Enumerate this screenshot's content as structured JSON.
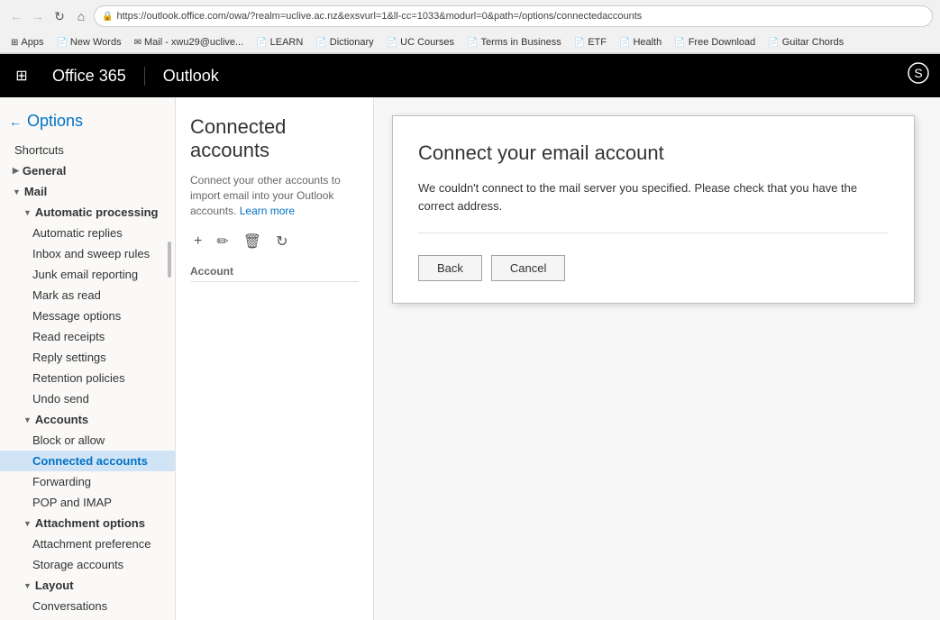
{
  "browser": {
    "nav_back_disabled": true,
    "nav_forward_disabled": true,
    "nav_refresh": "↻",
    "nav_home": "⌂",
    "address": "https://outlook.office.com/owa/?realm=uclive.ac.nz&exsvurl=1&ll-cc=1033&modurl=0&path=/options/connectedaccounts",
    "lock_icon": "🔒",
    "bookmarks": [
      {
        "label": "Apps",
        "icon": "⊞"
      },
      {
        "label": "New Words",
        "icon": "📄"
      },
      {
        "label": "Mail - xwu29@uclive...",
        "icon": "✉"
      },
      {
        "label": "LEARN",
        "icon": "📄"
      },
      {
        "label": "Dictionary",
        "icon": "📄"
      },
      {
        "label": "UC Courses",
        "icon": "📄"
      },
      {
        "label": "Terms in Business",
        "icon": "📄"
      },
      {
        "label": "ETF",
        "icon": "📄"
      },
      {
        "label": "Health",
        "icon": "📄"
      },
      {
        "label": "Free Download",
        "icon": "📄"
      },
      {
        "label": "Guitar Chords",
        "icon": "📄"
      }
    ]
  },
  "appbar": {
    "grid_icon": "⊞",
    "product": "Office 365",
    "app": "Outlook",
    "skype_icon": "S"
  },
  "sidebar": {
    "back_icon": "←",
    "title": "Options",
    "shortcuts": "Shortcuts",
    "general": "General",
    "mail": "Mail",
    "automatic_processing": "Automatic processing",
    "automatic_replies": "Automatic replies",
    "inbox_sweep": "Inbox and sweep rules",
    "junk_email": "Junk email reporting",
    "mark_as_read": "Mark as read",
    "message_options": "Message options",
    "read_receipts": "Read receipts",
    "reply_settings": "Reply settings",
    "retention_policies": "Retention policies",
    "undo_send": "Undo send",
    "accounts": "Accounts",
    "block_or_allow": "Block or allow",
    "connected_accounts": "Connected accounts",
    "forwarding": "Forwarding",
    "pop_imap": "POP and IMAP",
    "attachment_options": "Attachment options",
    "attachment_preference": "Attachment preference",
    "storage_accounts": "Storage accounts",
    "layout": "Layout",
    "conversations": "Conversations"
  },
  "connected_panel": {
    "title": "Connected accounts",
    "description": "Connect your other accounts to import email into your Outlook accounts.",
    "learn_more": "Learn more",
    "add_icon": "+",
    "edit_icon": "✏",
    "delete_icon": "🗑",
    "refresh_icon": "↻",
    "column_header": "Account"
  },
  "dialog": {
    "title": "Connect your email account",
    "message": "We couldn't connect to the mail server you specified. Please check that you have the correct address.",
    "back_label": "Back",
    "cancel_label": "Cancel"
  }
}
